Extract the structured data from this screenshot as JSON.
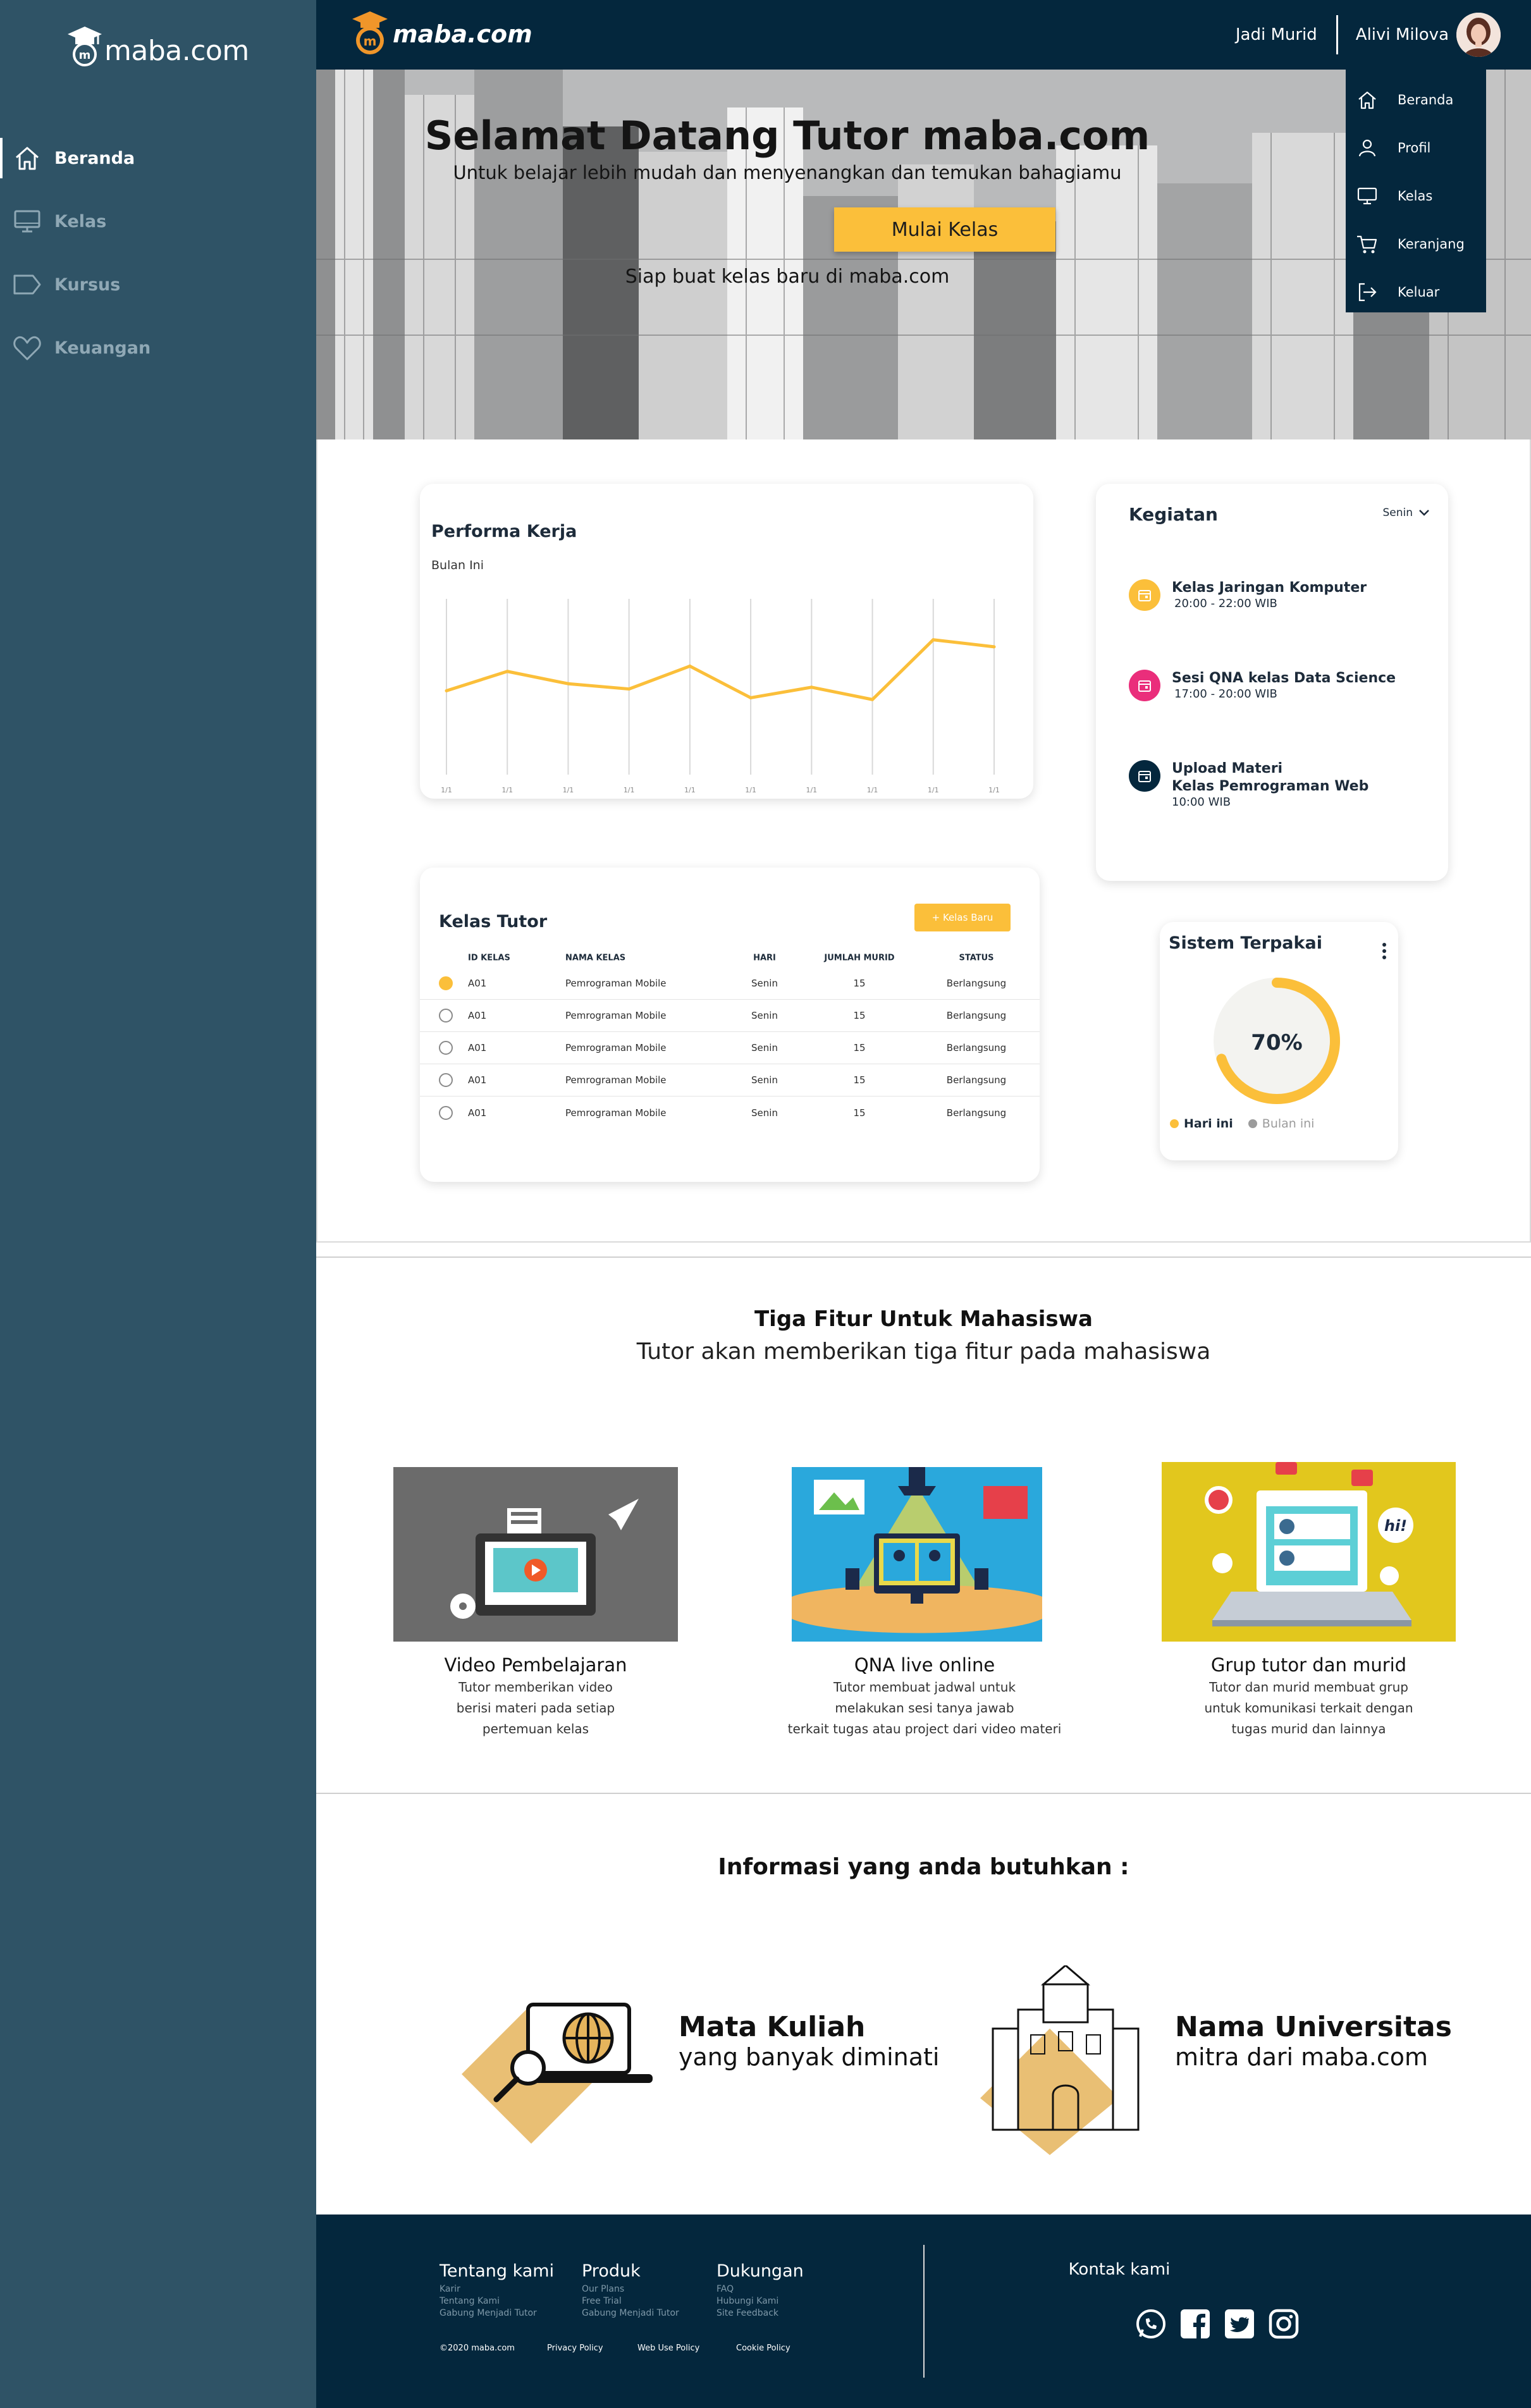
{
  "brand": {
    "name": "maba.com"
  },
  "sidebar": {
    "items": [
      {
        "label": "Beranda",
        "icon": "home-icon",
        "active": true
      },
      {
        "label": "Kelas",
        "icon": "monitor-icon",
        "active": false
      },
      {
        "label": "Kursus",
        "icon": "tag-icon",
        "active": false
      },
      {
        "label": "Keuangan",
        "icon": "heart-icon",
        "active": false
      }
    ]
  },
  "topbar": {
    "link": "Jadi Murid",
    "user_name": "Alivi Milova",
    "avatar_icon": "user-avatar"
  },
  "dropdown": {
    "items": [
      {
        "label": "Beranda",
        "icon": "home-icon"
      },
      {
        "label": "Profil",
        "icon": "user-icon"
      },
      {
        "label": "Kelas",
        "icon": "monitor-icon"
      },
      {
        "label": "Keranjang",
        "icon": "cart-icon"
      },
      {
        "label": "Keluar",
        "icon": "logout-icon"
      }
    ]
  },
  "hero": {
    "title": "Selamat Datang Tutor maba.com",
    "subtitle": "Untuk belajar lebih mudah dan menyenangkan dan temukan bahagiamu",
    "button": "Mulai Kelas",
    "note": "Siap buat kelas baru di maba.com"
  },
  "performa": {
    "title": "Performa Kerja",
    "subtitle": "Bulan Ini",
    "line_color": "#fbbf3a"
  },
  "chart_data": {
    "type": "line",
    "title": "Performa Kerja",
    "subtitle": "Bulan Ini",
    "categories": [
      "1/1",
      "1/1",
      "1/1",
      "1/1",
      "1/1",
      "1/1",
      "1/1",
      "1/1",
      "1/1",
      "1/1"
    ],
    "series": [
      {
        "values": [
          47,
          58,
          51,
          48,
          61,
          43,
          49,
          42,
          76,
          72
        ]
      }
    ],
    "ylim": [
      0,
      100
    ],
    "grid": "vertical"
  },
  "kegiatan": {
    "title": "Kegiatan",
    "day": "Senin",
    "events": [
      {
        "title": "Kelas Jaringan Komputer",
        "time": "20:00 - 22:00 WIB",
        "color": "#fbbf3a",
        "icon": "calendar-icon"
      },
      {
        "title": "Sesi QNA kelas Data Science",
        "time": "17:00 - 20:00 WIB",
        "color": "#ea2e7b",
        "icon": "calendar-icon"
      },
      {
        "title": "Upload Materi",
        "title2": "Kelas Pemrograman Web",
        "time": "10:00 WIB",
        "color": "#04273d",
        "icon": "calendar-icon"
      }
    ]
  },
  "kelas_tutor": {
    "title": "Kelas Tutor",
    "add_button": "+ Kelas Baru",
    "columns": [
      "ID KELAS",
      "NAMA KELAS",
      "HARI",
      "JUMLAH MURID",
      "STATUS"
    ],
    "rows": [
      {
        "id": "A01",
        "nama": "Pemrograman Mobile",
        "hari": "Senin",
        "jumlah": "15",
        "status": "Berlangsung",
        "checked": true
      },
      {
        "id": "A01",
        "nama": "Pemrograman Mobile",
        "hari": "Senin",
        "jumlah": "15",
        "status": "Berlangsung",
        "checked": false
      },
      {
        "id": "A01",
        "nama": "Pemrograman Mobile",
        "hari": "Senin",
        "jumlah": "15",
        "status": "Berlangsung",
        "checked": false
      },
      {
        "id": "A01",
        "nama": "Pemrograman Mobile",
        "hari": "Senin",
        "jumlah": "15",
        "status": "Berlangsung",
        "checked": false
      },
      {
        "id": "A01",
        "nama": "Pemrograman Mobile",
        "hari": "Senin",
        "jumlah": "15",
        "status": "Berlangsung",
        "checked": false
      }
    ]
  },
  "sistem": {
    "title": "Sistem Terpakai",
    "percent_label": "70%",
    "percent": 70,
    "legend": [
      {
        "label": "Hari ini",
        "color": "#fbbf3a"
      },
      {
        "label": "Bulan ini",
        "color": "#9b9b9b"
      }
    ]
  },
  "fitur": {
    "title": "Tiga Fitur Untuk Mahasiswa",
    "subtitle": "Tutor akan memberikan tiga fitur pada mahasiswa",
    "items": [
      {
        "title": "Video Pembelajaran",
        "lines": [
          "Tutor memberikan video",
          "berisi materi pada setiap",
          "pertemuan kelas"
        ]
      },
      {
        "title": "QNA live online",
        "lines": [
          "Tutor membuat jadwal untuk",
          "melakukan sesi tanya jawab",
          "terkait tugas atau project dari video materi"
        ]
      },
      {
        "title": "Grup tutor dan murid",
        "lines": [
          "Tutor dan murid membuat grup",
          "untuk komunikasi terkait dengan",
          "tugas murid dan lainnya"
        ]
      }
    ]
  },
  "info": {
    "title": "Informasi yang anda butuhkan :",
    "items": [
      {
        "title": "Mata Kuliah",
        "subtitle": "yang banyak diminati"
      },
      {
        "title": "Nama Universitas",
        "subtitle": "mitra dari maba.com"
      }
    ]
  },
  "footer": {
    "columns": [
      {
        "title": "Tentang kami",
        "links": [
          "Karir",
          "Tentang Kami",
          "Gabung Menjadi Tutor"
        ]
      },
      {
        "title": "Produk",
        "links": [
          "Our Plans",
          "Free Trial",
          "Gabung Menjadi Tutor"
        ]
      },
      {
        "title": "Dukungan",
        "links": [
          "FAQ",
          "Hubungi Kami",
          "Site Feedback"
        ]
      }
    ],
    "bottom": [
      "©2020 maba.com",
      "Privacy Policy",
      "Web Use Policy",
      "Cookie Policy"
    ],
    "contact_title": "Kontak kami",
    "social": [
      "whatsapp-icon",
      "facebook-icon",
      "twitter-icon",
      "instagram-icon"
    ]
  }
}
